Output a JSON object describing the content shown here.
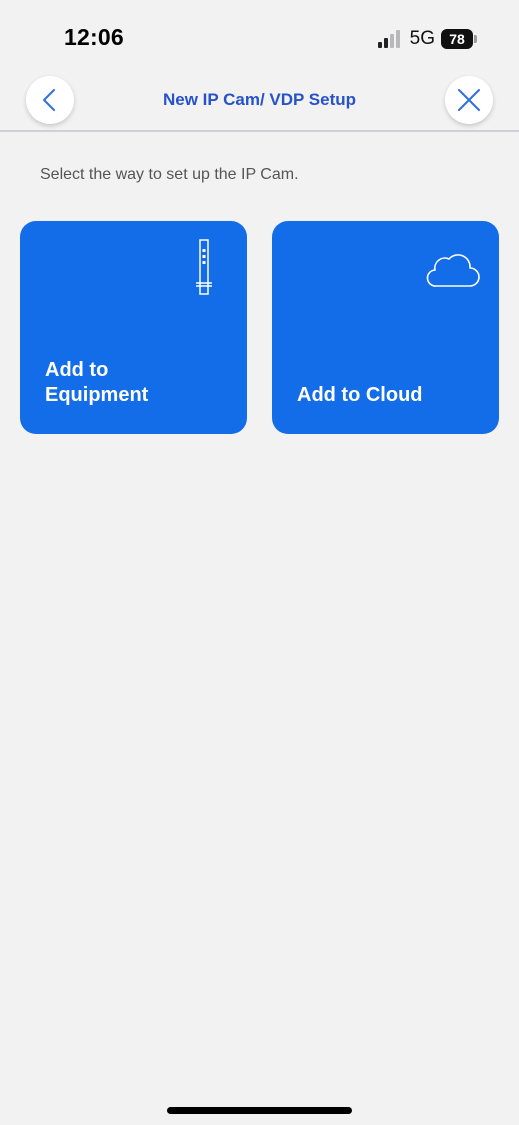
{
  "status_bar": {
    "time": "12:06",
    "network": "5G",
    "battery": "78"
  },
  "header": {
    "title": "New IP Cam/ VDP Setup",
    "back_icon": "chevron-left-icon",
    "close_icon": "close-icon"
  },
  "instruction": "Select the way to set up the IP Cam.",
  "options": [
    {
      "label": "Add to\nEquipment",
      "icon": "intercom-device-icon"
    },
    {
      "label": "Add to Cloud",
      "icon": "cloud-icon"
    }
  ],
  "colors": {
    "background": "#f2f2f3",
    "accent": "#136ce8",
    "title": "#2753c9"
  }
}
